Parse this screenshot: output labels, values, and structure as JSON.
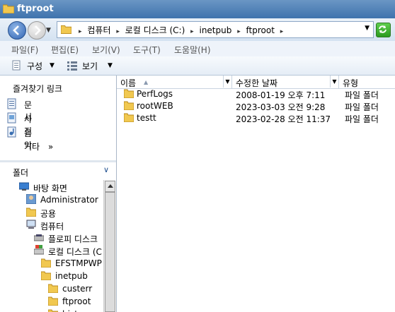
{
  "window": {
    "title": "ftproot"
  },
  "address": {
    "crumbs": [
      "컴퓨터",
      "로컬 디스크 (C:)",
      "inetpub",
      "ftproot"
    ]
  },
  "menu": [
    "파일(F)",
    "편집(E)",
    "보기(V)",
    "도구(T)",
    "도움말(H)"
  ],
  "toolbar": {
    "organize": "구성",
    "views": "보기"
  },
  "favorites": {
    "heading": "즐겨찾기 링크",
    "items": [
      "문서",
      "사진",
      "음악"
    ],
    "more": "기타"
  },
  "folders": {
    "heading": "폴더",
    "tree": [
      {
        "label": "바탕 화면"
      },
      {
        "label": "Administrator"
      },
      {
        "label": "공용"
      },
      {
        "label": "컴퓨터"
      },
      {
        "label": "플로피 디스크"
      },
      {
        "label": "로컬 디스크 (C"
      },
      {
        "label": "EFSTMPWP"
      },
      {
        "label": "inetpub"
      },
      {
        "label": "custerr"
      },
      {
        "label": "ftproot"
      },
      {
        "label": "history"
      }
    ]
  },
  "columns": {
    "name": "이름",
    "date": "수정한 날짜",
    "type": "유형"
  },
  "files": [
    {
      "name": "PerfLogs",
      "date": "2008-01-19 오후 7:11",
      "type": "파일 폴더"
    },
    {
      "name": "rootWEB",
      "date": "2023-03-03 오전 9:28",
      "type": "파일 폴더"
    },
    {
      "name": "testt",
      "date": "2023-02-28 오전 11:37",
      "type": "파일 폴더"
    }
  ],
  "colors": {
    "titlebar": "#3f73ad",
    "folder": "#e8b838",
    "accent": "#1f4f8f"
  }
}
